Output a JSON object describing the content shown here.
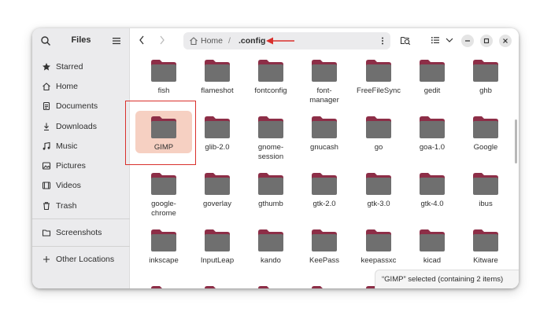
{
  "sidebar": {
    "title": "Files",
    "items": [
      {
        "label": "Starred",
        "icon": "star-icon"
      },
      {
        "label": "Home",
        "icon": "home-icon"
      },
      {
        "label": "Documents",
        "icon": "document-icon"
      },
      {
        "label": "Downloads",
        "icon": "download-icon"
      },
      {
        "label": "Music",
        "icon": "music-icon"
      },
      {
        "label": "Pictures",
        "icon": "picture-icon"
      },
      {
        "label": "Videos",
        "icon": "video-icon"
      },
      {
        "label": "Trash",
        "icon": "trash-icon"
      },
      {
        "label": "Screenshots",
        "icon": "folder-icon"
      },
      {
        "label": "Other Locations",
        "icon": "plus-icon"
      }
    ]
  },
  "pathbar": {
    "home": "Home",
    "separator": "/",
    "current": ".config"
  },
  "folders": [
    "fish",
    "flameshot",
    "fontconfig",
    "font-\nmanager",
    "FreeFileSync",
    "gedit",
    "ghb",
    "GIMP",
    "glib-2.0",
    "gnome-\nsession",
    "gnucash",
    "go",
    "goa-1.0",
    "Google",
    "google-\nchrome",
    "goverlay",
    "gthumb",
    "gtk-2.0",
    "gtk-3.0",
    "gtk-4.0",
    "ibus",
    "inkscape",
    "InputLeap",
    "kando",
    "KeePass",
    "keepassxc",
    "kicad",
    "Kitware",
    "",
    "",
    "",
    "",
    "",
    "",
    ""
  ],
  "selected_folder": "GIMP",
  "status": "“GIMP” selected  (containing 2 items)",
  "colors": {
    "folder_body": "#6f6f6f",
    "folder_tab": "#8d2e47",
    "selection": "#f6d0c2",
    "annotation": "#d9302c"
  }
}
